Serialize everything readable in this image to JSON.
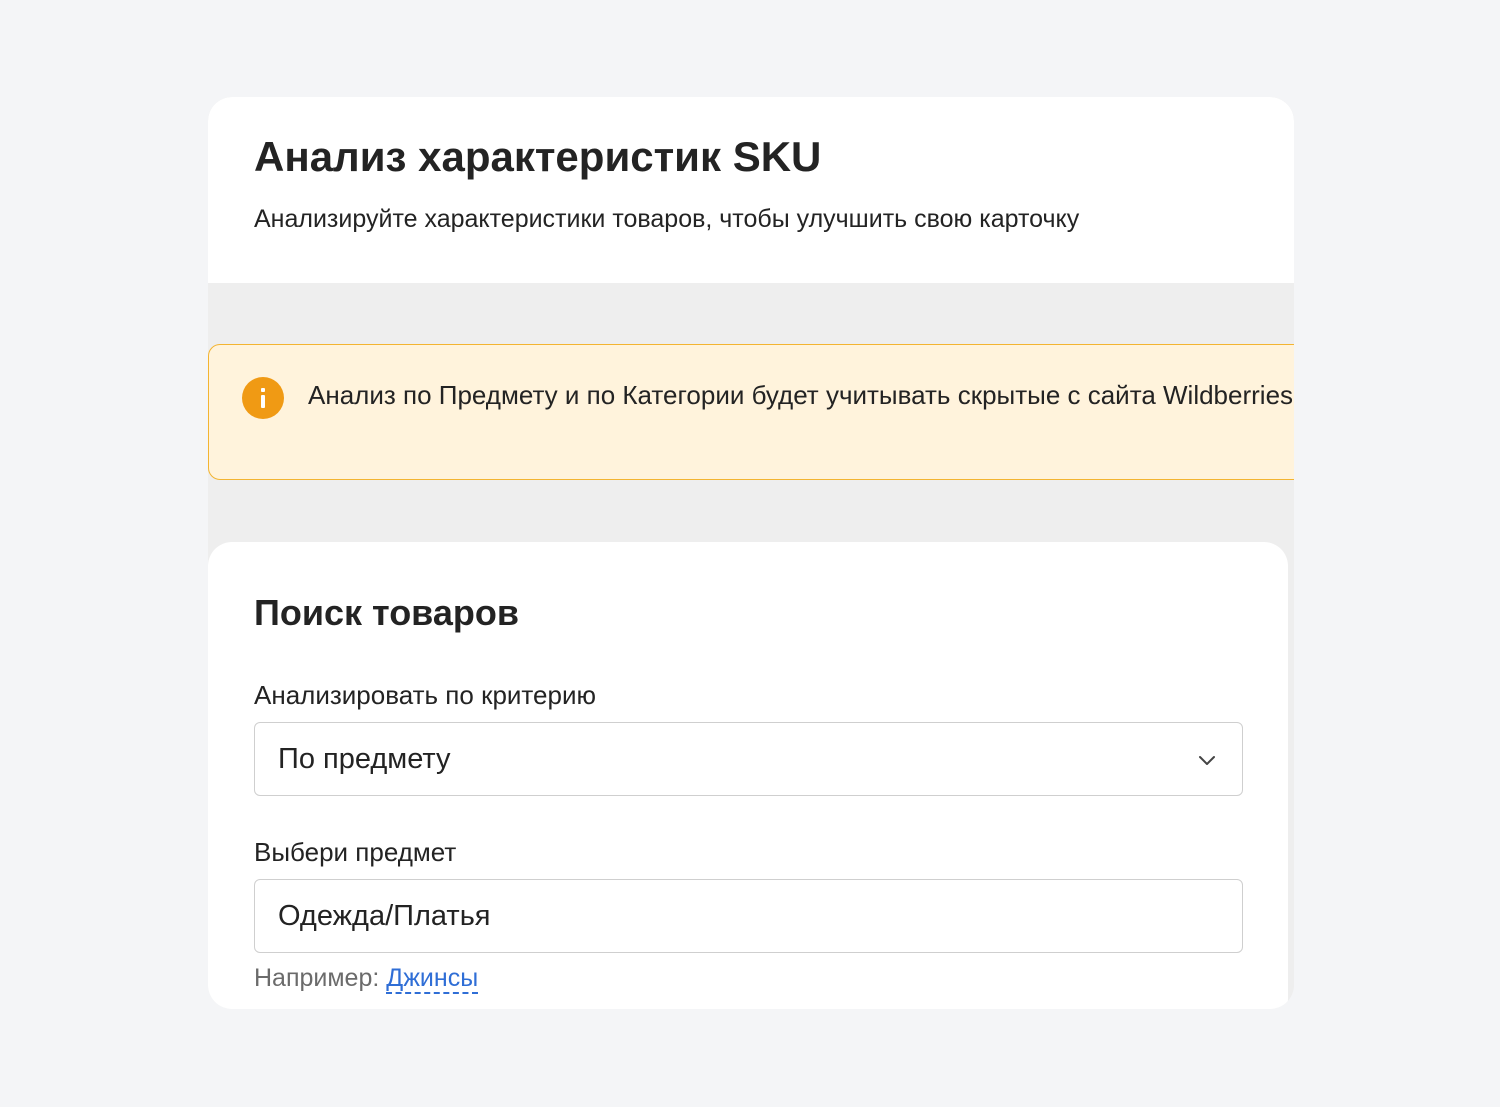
{
  "header": {
    "title": "Анализ характеристик SKU",
    "subtitle": "Анализируйте характеристики товаров, чтобы улучшить свою карточку"
  },
  "notice": {
    "icon": "info-icon",
    "text": "Анализ по Предмету и по Категории будет учитывать скрытые с сайта Wildberries"
  },
  "search": {
    "title": "Поиск товаров",
    "criteria_label": "Анализировать по критерию",
    "criteria_value": "По предмету",
    "subject_label": "Выбери предмет",
    "subject_value": "Одежда/Платья",
    "hint_prefix": "Например: ",
    "hint_example": "Джинсы"
  },
  "colors": {
    "page_bg": "#f4f5f7",
    "notice_bg": "#fff3dc",
    "notice_border": "#f3b431",
    "notice_icon": "#f09a14",
    "link": "#2f6ed6"
  }
}
